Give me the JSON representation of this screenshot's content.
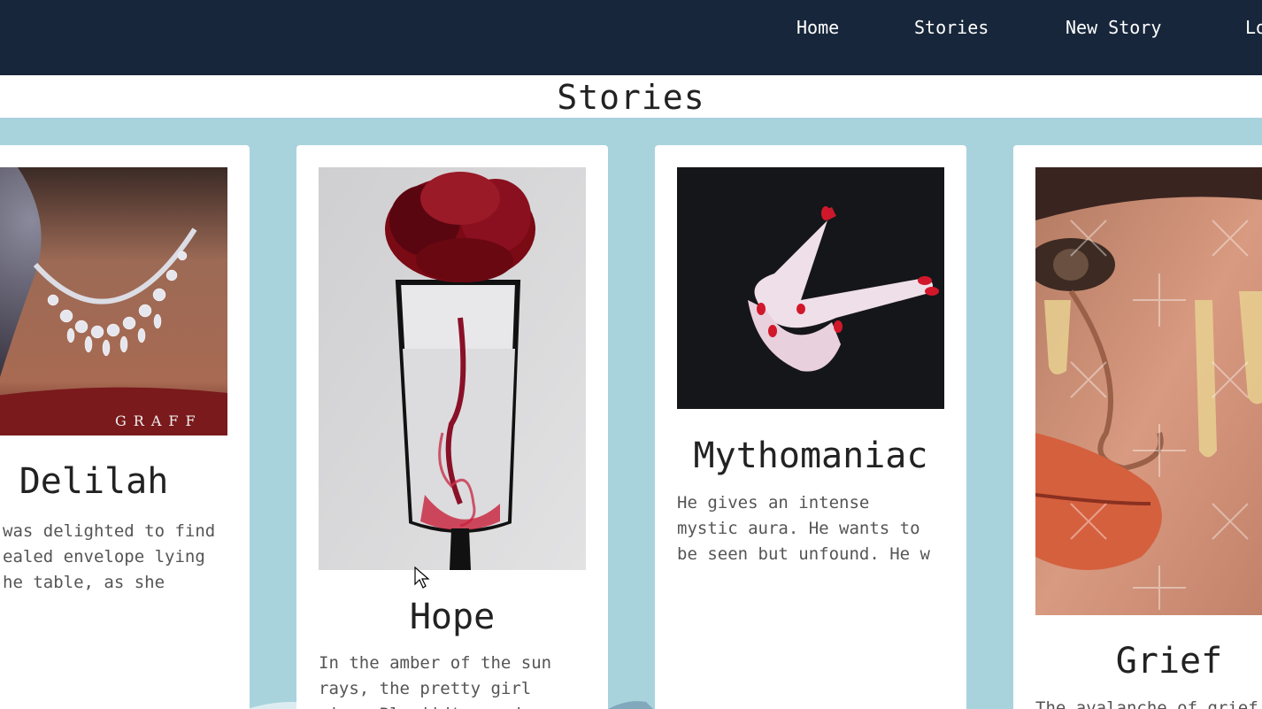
{
  "nav": {
    "items": [
      {
        "label": "Home"
      },
      {
        "label": "Stories"
      },
      {
        "label": "New Story"
      },
      {
        "label": "Lo"
      }
    ]
  },
  "page": {
    "title": "Stories"
  },
  "stories": [
    {
      "title": "Delilah",
      "excerpt": "was delighted to find\nealed envelope lying\nhe table, as she",
      "image": "necklace-photo",
      "image_caption": "GRAFF"
    },
    {
      "title": "Hope",
      "excerpt": "In the amber of the sun\nrays, the pretty girl\nvice. Blarjid's ...d.",
      "image": "rose-in-glass-photo"
    },
    {
      "title": "Mythomaniac",
      "excerpt": "He gives an intense\nmystic aura. He wants to\nbe seen but unfound. He w",
      "image": "hands-gesture-photo"
    },
    {
      "title": "Grief",
      "excerpt": "The avalanche of grief",
      "image": "glitter-tears-face-photo"
    }
  ],
  "colors": {
    "navbar": "#17263a",
    "background": "#a8d3dc",
    "card": "#ffffff",
    "text": "#222222"
  }
}
